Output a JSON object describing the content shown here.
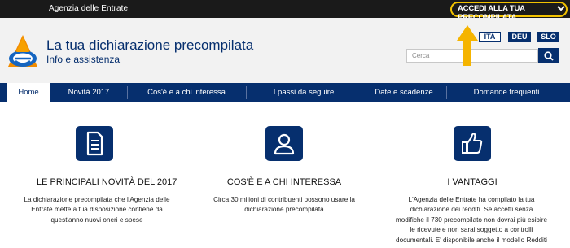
{
  "topbar": {
    "agency": "Agenzia delle Entrate",
    "login_label": "ACCEDI ALLA TUA PRECOMPILATA"
  },
  "header": {
    "title": "La tua dichiarazione precompilata",
    "subtitle": "Info e assistenza",
    "languages": [
      "ITA",
      "DEU",
      "SLO"
    ],
    "search_placeholder": "Cerca"
  },
  "nav": {
    "items": [
      "Home",
      "Novità 2017",
      "Cos'è e a chi interessa",
      "I passi da seguire",
      "Date e scadenze",
      "Domande frequenti"
    ]
  },
  "cards": [
    {
      "icon": "document-icon",
      "title": "LE PRINCIPALI NOVITÀ DEL 2017",
      "lines": [
        "La dichiarazione precompilata che l'Agenzia delle",
        "Entrate mette a tua disposizione contiene da",
        "quest'anno nuovi oneri e spese"
      ]
    },
    {
      "icon": "user-icon",
      "title": "COS'È E A CHI INTERESSA",
      "lines": [
        "Circa 30 milioni di contribuenti possono usare la",
        "dichiarazione precompilata"
      ]
    },
    {
      "icon": "thumbs-up-icon",
      "title": "I VANTAGGI",
      "lines": [
        "L'Agenzia delle Entrate  ha compilato la tua",
        "dichiarazione dei redditi. Se accetti senza",
        "modifiche il 730 precompilato non dovrai più esibire",
        "le ricevute e non sarai soggetto a controlli",
        "documentali. E' disponibile anche il modello Redditi"
      ]
    }
  ],
  "colors": {
    "brand": "#062f6e",
    "highlight": "#f2c200",
    "topbar": "#1a1a1a"
  }
}
